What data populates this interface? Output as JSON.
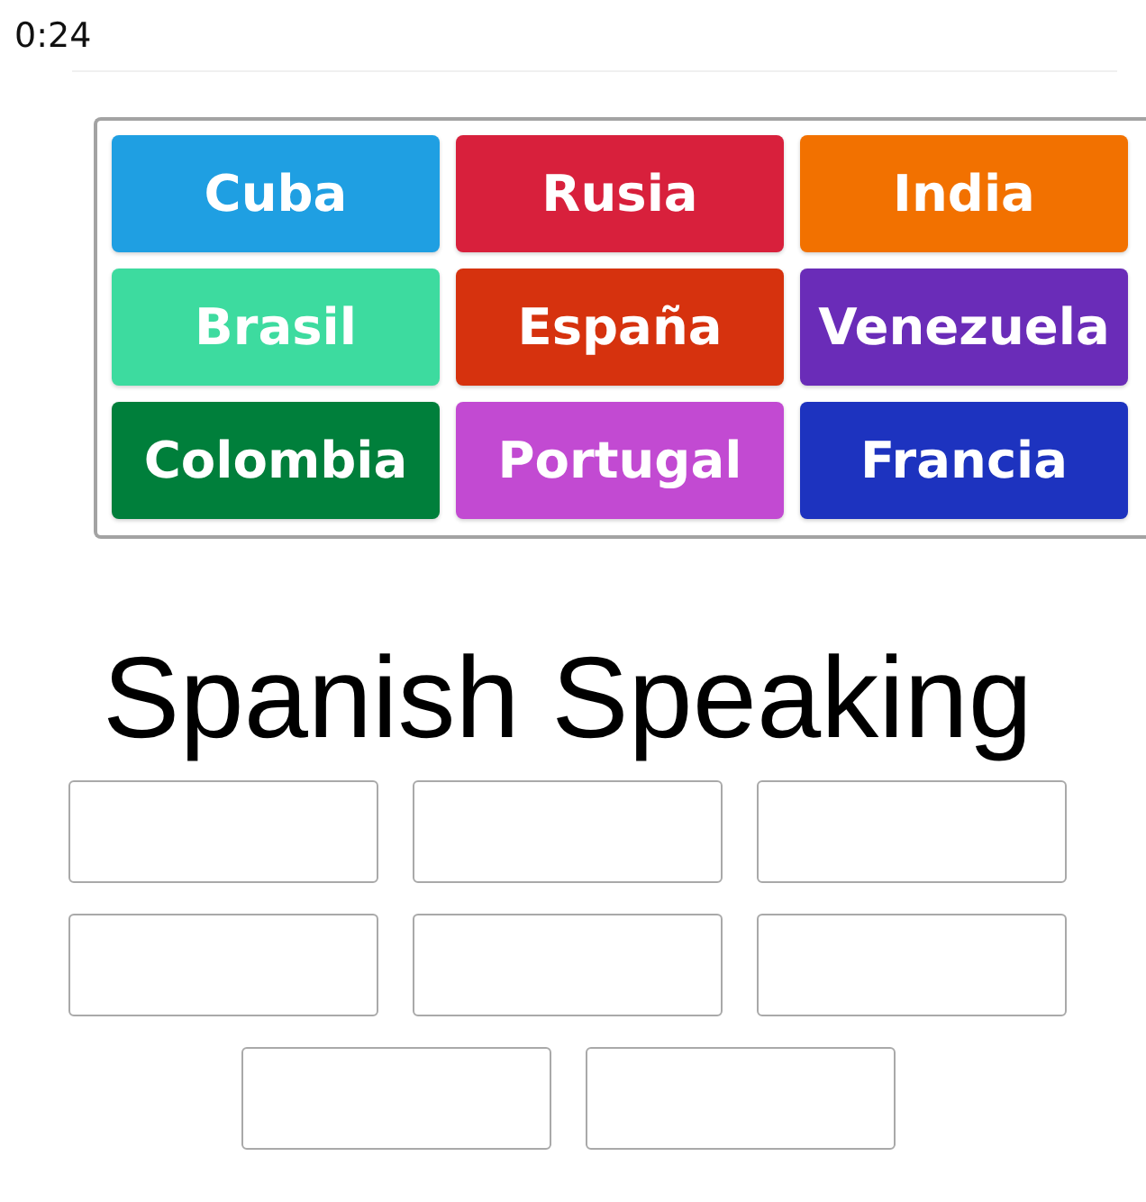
{
  "timer": "0:24",
  "tray": {
    "tiles": [
      {
        "label": "Cuba",
        "color": "#1f9fe2"
      },
      {
        "label": "Rusia",
        "color": "#d8203c"
      },
      {
        "label": "India",
        "color": "#f27100"
      },
      {
        "label": "Brasil",
        "color": "#3ddb9f"
      },
      {
        "label": "España",
        "color": "#d6320e"
      },
      {
        "label": "Venezuela",
        "color": "#6a2cb8"
      },
      {
        "label": "Colombia",
        "color": "#007f3b"
      },
      {
        "label": "Portugal",
        "color": "#c24ad2"
      },
      {
        "label": "Francia",
        "color": "#1d33bf"
      }
    ]
  },
  "category": {
    "title": "Spanish Speaking",
    "slots": [
      {
        "filled": false
      },
      {
        "filled": false
      },
      {
        "filled": false
      },
      {
        "filled": false
      },
      {
        "filled": false
      },
      {
        "filled": false
      },
      {
        "filled": false
      },
      {
        "filled": false
      }
    ]
  }
}
